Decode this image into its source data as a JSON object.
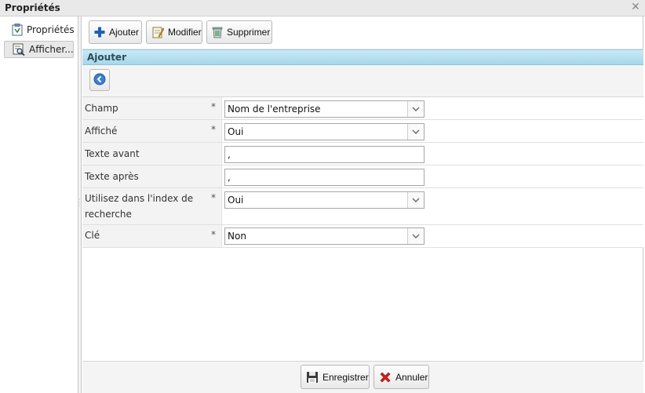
{
  "window": {
    "title": "Propriétés",
    "close_icon": "close-icon"
  },
  "sidebar": {
    "items": [
      {
        "label": "Propriétés",
        "icon": "clipboard-icon",
        "active": false
      },
      {
        "label": "Afficher...",
        "icon": "display-search-icon",
        "active": true
      }
    ]
  },
  "toolbar": {
    "add_label": "Ajouter",
    "edit_label": "Modifier",
    "delete_label": "Supprimer"
  },
  "section": {
    "title": "Ajouter"
  },
  "form": {
    "rows": [
      {
        "label": "Champ",
        "required": "*",
        "value": "Nom de l'entreprise",
        "type": "select"
      },
      {
        "label": "Affiché",
        "required": "*",
        "value": "Oui",
        "type": "select"
      },
      {
        "label": "Texte avant",
        "required": "",
        "value": ",",
        "type": "text"
      },
      {
        "label": "Texte après",
        "required": "",
        "value": ",",
        "type": "text"
      },
      {
        "label": "Utilisez dans l'index de recherche",
        "required": "*",
        "value": "Oui",
        "type": "select"
      },
      {
        "label": "Clé",
        "required": "*",
        "value": "Non",
        "type": "select"
      }
    ]
  },
  "footer": {
    "save_label": "Enregistrer",
    "cancel_label": "Annuler"
  },
  "colors": {
    "header_bg": "#b7e0ef",
    "header_text": "#2a4d5c",
    "cancel_red": "#d21f1f",
    "add_blue": "#1e5fb3"
  }
}
